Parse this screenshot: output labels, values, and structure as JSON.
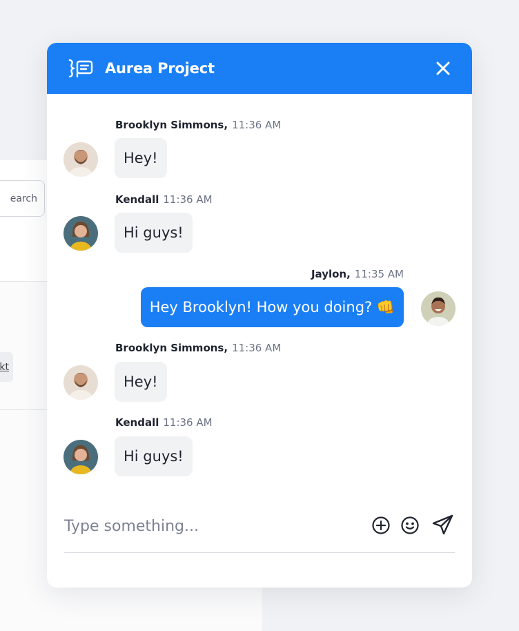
{
  "background": {
    "search_label": "earch",
    "next_label": "kt"
  },
  "header": {
    "title": "Aurea Project",
    "accent": "#1a7ff5"
  },
  "messages": [
    {
      "author": "Brooklyn Simmons,",
      "time": "11:36 AM",
      "text": "Hey!",
      "direction": "in",
      "avatar": "man-beard-avatar"
    },
    {
      "author": "Kendall",
      "time": "11:36 AM",
      "text": "Hi guys!",
      "direction": "in",
      "avatar": "woman-avatar"
    },
    {
      "author": "Jaylon,",
      "time": "11:35 AM",
      "text": "Hey Brooklyn! How you doing? 👊",
      "direction": "out",
      "avatar": "smiling-man-avatar"
    },
    {
      "author": "Brooklyn Simmons,",
      "time": "11:36 AM",
      "text": "Hey!",
      "direction": "in",
      "avatar": "man-beard-avatar"
    },
    {
      "author": "Kendall",
      "time": "11:36 AM",
      "text": "Hi guys!",
      "direction": "in",
      "avatar": "woman-avatar"
    }
  ],
  "composer": {
    "placeholder": "Type something..."
  }
}
